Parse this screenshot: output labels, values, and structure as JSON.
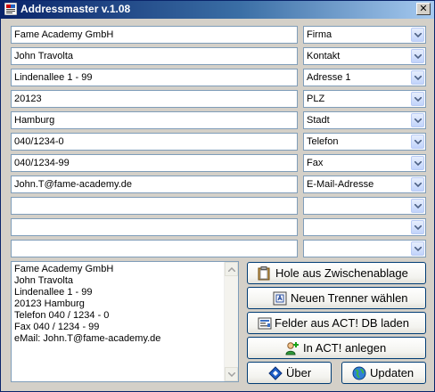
{
  "window": {
    "title": "Addressmaster v.1.08",
    "close_label": "✕"
  },
  "rows": [
    {
      "value": "Fame Academy GmbH",
      "field": "Firma"
    },
    {
      "value": "John Travolta",
      "field": "Kontakt"
    },
    {
      "value": "Lindenallee 1 - 99",
      "field": "Adresse 1"
    },
    {
      "value": "20123",
      "field": "PLZ"
    },
    {
      "value": "Hamburg",
      "field": "Stadt"
    },
    {
      "value": "040/1234-0",
      "field": "Telefon"
    },
    {
      "value": "040/1234-99",
      "field": "Fax"
    },
    {
      "value": "John.T@fame-academy.de",
      "field": "E-Mail-Adresse"
    },
    {
      "value": "",
      "field": ""
    },
    {
      "value": "",
      "field": ""
    },
    {
      "value": "",
      "field": ""
    }
  ],
  "memo": {
    "lines": [
      "Fame Academy GmbH",
      "John Travolta",
      "Lindenallee 1 - 99",
      "20123 Hamburg",
      "Telefon 040 / 1234 - 0",
      "Fax 040 / 1234 - 99",
      "eMail: John.T@fame-academy.de"
    ]
  },
  "buttons": {
    "clipboard": "Hole aus Zwischenablage",
    "separator": "Neuen Trenner wählen",
    "load_fields": "Felder aus ACT! DB laden",
    "create": "In ACT! anlegen",
    "about": "Über",
    "updates": "Updaten"
  },
  "colors": {
    "title_start": "#0a246a",
    "title_end": "#a6caf0",
    "dialog_bg": "#d4d0c8",
    "field_border": "#7f9db9",
    "button_border": "#003c74"
  }
}
